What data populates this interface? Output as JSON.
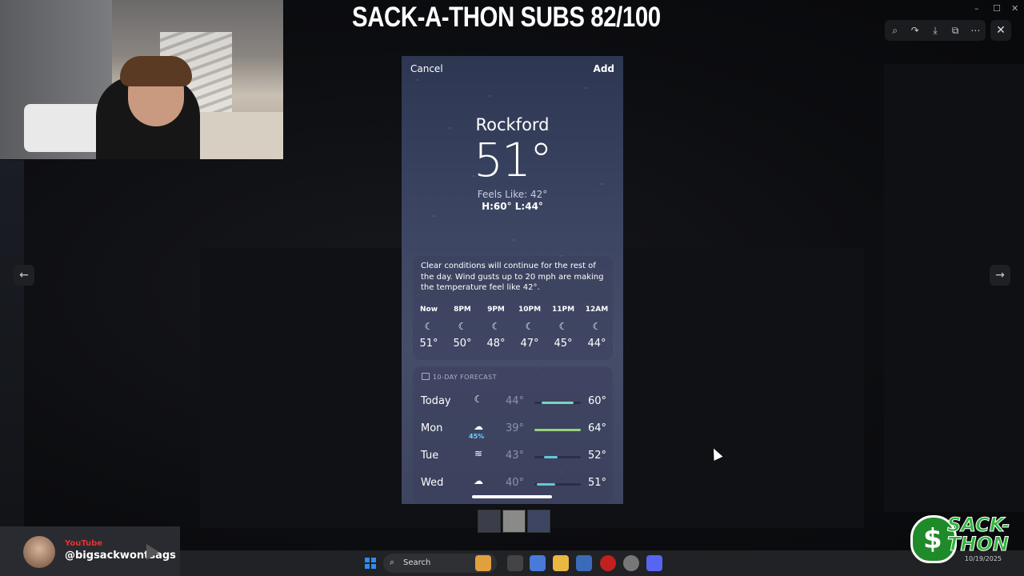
{
  "overlay": {
    "title": "SACK-A-THON SUBS 82/100"
  },
  "viewer": {
    "close_symbol": "✕",
    "prev_symbol": "←",
    "next_symbol": "→"
  },
  "weather": {
    "cancel_label": "Cancel",
    "add_label": "Add",
    "city": "Rockford",
    "temperature": "51°",
    "feels_like": "Feels Like: 42°",
    "hi_lo": "H:60°  L:44°",
    "summary": "Clear conditions will continue for the rest of the day. Wind gusts up to 20 mph are making the temperature feel like 42°.",
    "hourly": [
      {
        "label": "Now",
        "temp": "51°",
        "icon": "moon-icon"
      },
      {
        "label": "8PM",
        "temp": "50°",
        "icon": "moon-icon"
      },
      {
        "label": "9PM",
        "temp": "48°",
        "icon": "moon-icon"
      },
      {
        "label": "10PM",
        "temp": "47°",
        "icon": "moon-icon"
      },
      {
        "label": "11PM",
        "temp": "45°",
        "icon": "moon-icon"
      },
      {
        "label": "12AM",
        "temp": "44°",
        "icon": "moon-icon"
      }
    ],
    "forecast_header": "10-DAY FORECAST",
    "forecast": [
      {
        "day": "Today",
        "icon": "moon-icon",
        "pop": "",
        "low": "44°",
        "high": "60°",
        "range": [
          0.15,
          0.85
        ],
        "color": "#7dd3c0"
      },
      {
        "day": "Mon",
        "icon": "rain-cloud-icon",
        "pop": "45%",
        "low": "39°",
        "high": "64°",
        "range": [
          0.0,
          1.0
        ],
        "color": "#9ad27a"
      },
      {
        "day": "Tue",
        "icon": "wind-icon",
        "pop": "",
        "low": "43°",
        "high": "52°",
        "range": [
          0.2,
          0.5
        ],
        "color": "#62c7d8"
      },
      {
        "day": "Wed",
        "icon": "cloud-icon",
        "pop": "",
        "low": "40°",
        "high": "51°",
        "range": [
          0.05,
          0.45
        ],
        "color": "#62c7d8"
      }
    ]
  },
  "stream": {
    "yt_tag": "YouTube",
    "yt_handle": "@bigsackwontsags"
  },
  "taskbar": {
    "search_label": "Search",
    "date": "10/19/2025"
  },
  "logo": {
    "text_line1": "SACK-",
    "text_line2": "THON"
  },
  "colors": {
    "accent": "#2b8ef3",
    "logo_green": "#2fb53c",
    "yt_red": "#e23232"
  }
}
